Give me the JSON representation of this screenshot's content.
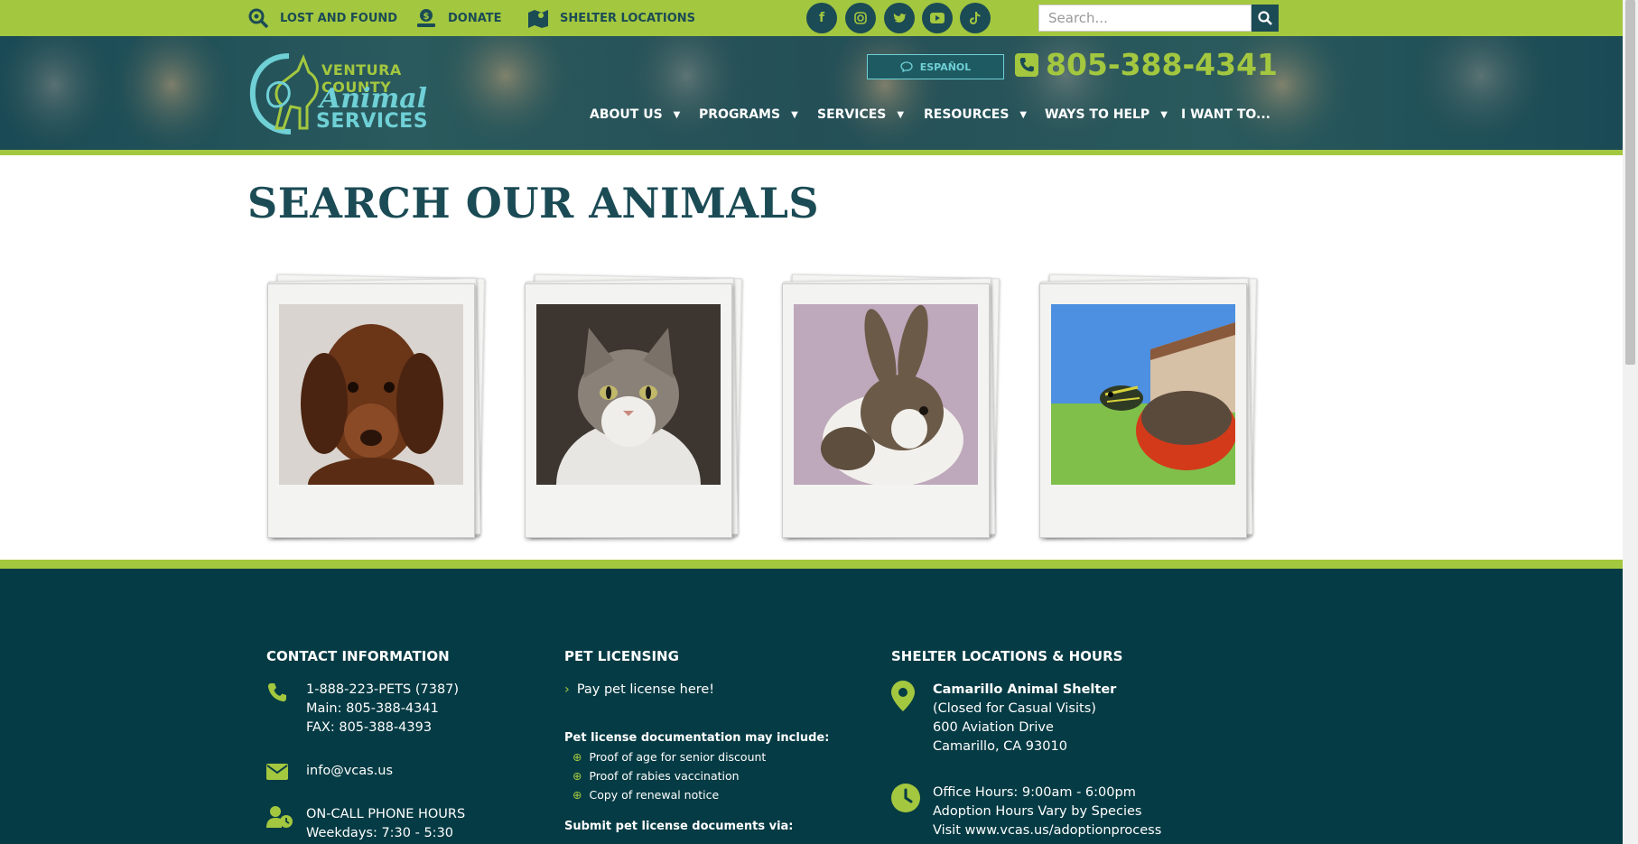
{
  "colors": {
    "green": "#a3c73f",
    "teal": "#1b4b55",
    "footer": "#053b44",
    "light_teal": "#6fd0d6"
  },
  "topbar": {
    "lost_and_found": "LOST AND FOUND",
    "donate": "DONATE",
    "shelter_locations": "SHELTER LOCATIONS",
    "social_icons": [
      "facebook-icon",
      "instagram-icon",
      "twitter-icon",
      "youtube-icon",
      "tiktok-icon"
    ],
    "search_placeholder": "Search..."
  },
  "header": {
    "logo": {
      "line1": "VENTURA COUNTY",
      "line2": "Animal",
      "line3": "SERVICES"
    },
    "espanol": "ESPAÑOL",
    "phone": "805-388-4341",
    "nav": [
      "ABOUT US",
      "PROGRAMS",
      "SERVICES",
      "RESOURCES",
      "WAYS TO HELP",
      "I WANT TO..."
    ]
  },
  "main": {
    "title": "SEARCH OUR ANIMALS",
    "animals": [
      "dog",
      "cat",
      "rabbit",
      "turtle"
    ]
  },
  "footer": {
    "contact": {
      "heading": "CONTACT INFORMATION",
      "phone1": "1-888-223-PETS (7387)",
      "phone2": "Main: 805-388-4341",
      "fax": "FAX: 805-388-4393",
      "email": "info@vcas.us",
      "oncall_heading": "ON-CALL PHONE HOURS",
      "oncall_hours": "Weekdays: 7:30 - 5:30"
    },
    "licensing": {
      "heading": "PET LICENSING",
      "pay_link": "Pay pet license here!",
      "docs_heading": "Pet license documentation may include:",
      "docs": [
        "Proof of age for senior discount",
        "Proof of rabies vaccination",
        "Copy of renewal notice"
      ],
      "submit_heading": "Submit pet license documents via:"
    },
    "shelter": {
      "heading": "SHELTER LOCATIONS & HOURS",
      "name": "Camarillo Animal Shelter",
      "note": "(Closed for Casual Visits)",
      "street": "600 Aviation Drive",
      "city": "Camarillo, CA 93010",
      "office_hours": "Office Hours: 9:00am - 6:00pm",
      "adoption_hours": "Adoption Hours Vary by Species",
      "visit": "Visit www.vcas.us/adoptionprocess"
    }
  }
}
